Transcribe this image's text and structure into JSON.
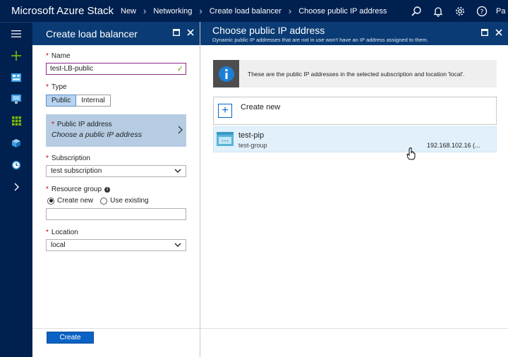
{
  "topbar": {
    "brand": "Microsoft Azure Stack",
    "breadcrumbs": [
      "New",
      "Networking",
      "Create load balancer",
      "Choose public IP address"
    ],
    "icons": [
      "search-icon",
      "notifications-icon",
      "settings-icon",
      "help-icon"
    ],
    "user": "Pa"
  },
  "rail": {
    "items": [
      "hamburger-menu-icon",
      "new-plus-icon",
      "dashboard-icon",
      "monitor-icon",
      "all-resources-icon",
      "cube-icon",
      "clock-icon",
      "expand-chevron-icon"
    ]
  },
  "blade1": {
    "title": "Create load balancer",
    "name_label": "Name",
    "name_value": "test-LB-public",
    "type_label": "Type",
    "type_options": [
      "Public",
      "Internal"
    ],
    "type_selected": "Public",
    "public_ip_label": "Public IP address",
    "public_ip_value": "Choose a public IP address",
    "subscription_label": "Subscription",
    "subscription_value": "test subscription",
    "resource_group_label": "Resource group",
    "rg_create_new": "Create new",
    "rg_use_existing": "Use existing",
    "rg_value": "",
    "location_label": "Location",
    "location_value": "local",
    "create_button": "Create"
  },
  "blade2": {
    "title": "Choose public IP address",
    "subtitle": "Dynamic public IP addresses that are not in use won't have an IP address assigned to them.",
    "info_text": "These are the public IP addresses in the selected subscription and location 'local'.",
    "create_new": "Create new",
    "items": [
      {
        "name": "test-pip",
        "group": "test-group",
        "ip": "192.168.102.16 (..."
      }
    ]
  },
  "colors": {
    "topbar_bg": "#002050",
    "blade_header_bg": "#0a3b74",
    "selected_row_bg": "#e1f0fb",
    "accent_blue": "#0a62c4",
    "selector_bg": "#b5cce3"
  }
}
